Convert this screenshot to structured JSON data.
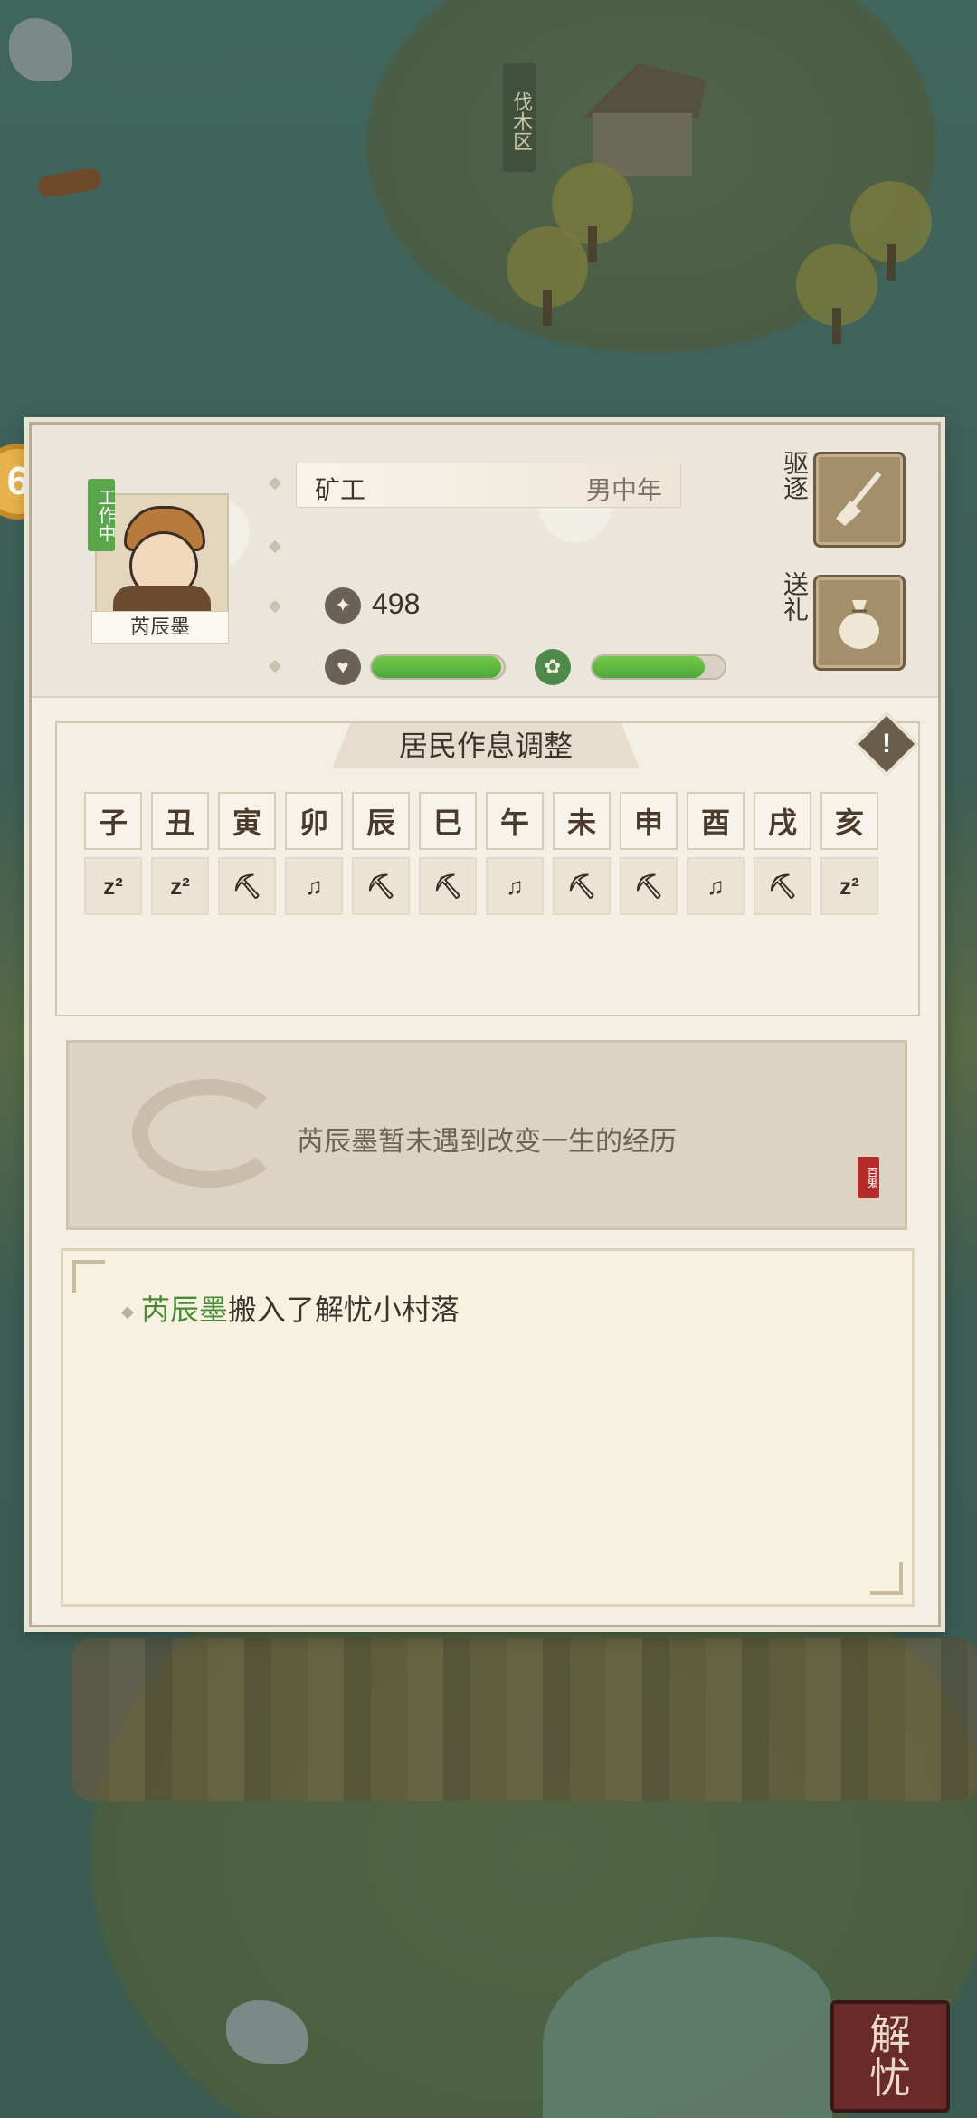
{
  "map": {
    "zone_label": "伐木区",
    "side_button_label": "6",
    "seal_text": [
      "解",
      "忧"
    ]
  },
  "resident": {
    "status": "工作中",
    "name": "芮辰墨",
    "job": "矿工",
    "gender_age": "男中年",
    "coins": "498",
    "health_fraction": 0.98,
    "mood_fraction": 0.85
  },
  "actions": {
    "expel_label": "驱逐",
    "gift_label": "送礼"
  },
  "schedule": {
    "title": "居民作息调整",
    "hours": [
      "子",
      "丑",
      "寅",
      "卯",
      "辰",
      "巳",
      "午",
      "未",
      "申",
      "酉",
      "戌",
      "亥"
    ],
    "activities": [
      "sleep",
      "sleep",
      "work",
      "leisure",
      "work",
      "work",
      "leisure",
      "work",
      "work",
      "leisure",
      "work",
      "sleep"
    ]
  },
  "history": {
    "text": "芮辰墨暂未遇到改变一生的经历",
    "stamp": "百鬼"
  },
  "log": {
    "entries": [
      {
        "who": "芮辰墨",
        "text": "搬入了解忧小村落"
      }
    ]
  },
  "colors": {
    "accent_green": "#4ea83a",
    "panel_bg": "#f3efe5",
    "seal_red": "#6a2a2a"
  }
}
